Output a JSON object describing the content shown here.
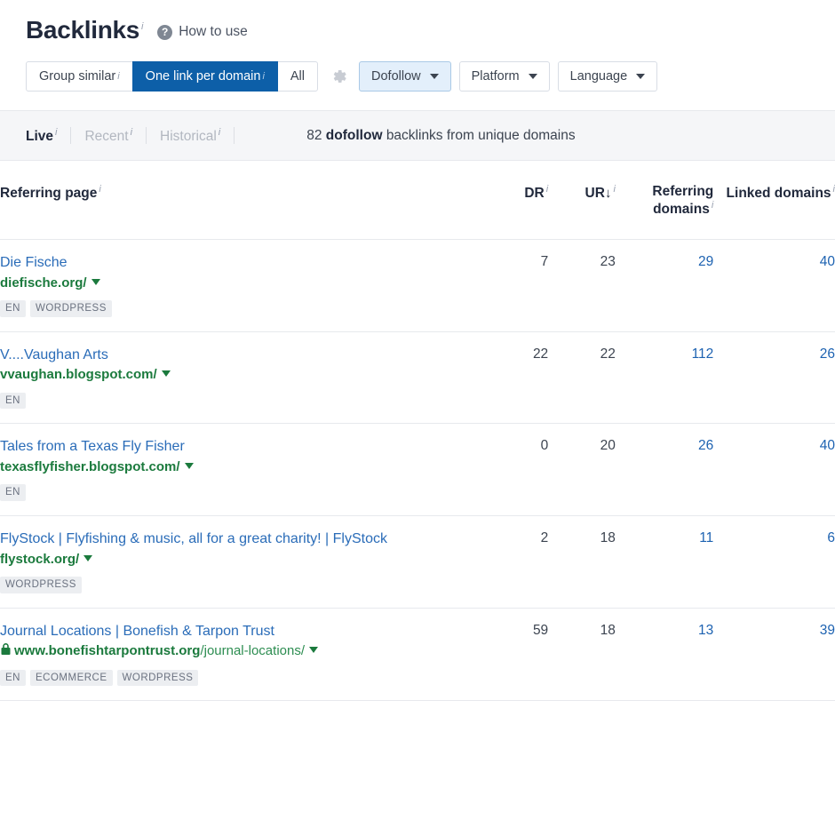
{
  "header": {
    "title": "Backlinks",
    "title_info": "i",
    "how_to_use": "How to use",
    "help_icon": "?"
  },
  "toolbar": {
    "segments": [
      {
        "label": "Group similar",
        "info": "i",
        "active": false
      },
      {
        "label": "One link per domain",
        "info": "i",
        "active": true
      },
      {
        "label": "All",
        "info": "",
        "active": false
      }
    ],
    "gear_icon": "gear-icon",
    "filters": [
      {
        "label": "Dofollow",
        "selected": true
      },
      {
        "label": "Platform",
        "selected": false
      },
      {
        "label": "Language",
        "selected": false
      }
    ],
    "accent_color": "#0d5fa8",
    "selected_filter_bg": "#e3effb"
  },
  "subbar": {
    "states": [
      {
        "label": "Live",
        "info": "i",
        "active": true
      },
      {
        "label": "Recent",
        "info": "i",
        "active": false
      },
      {
        "label": "Historical",
        "info": "i",
        "active": false
      }
    ],
    "summary_count": "82",
    "summary_emphasis": "dofollow",
    "summary_prefix": "",
    "summary_suffix": "backlinks from unique domains"
  },
  "table": {
    "columns": [
      {
        "key": "page",
        "label": "Referring page",
        "info": "i"
      },
      {
        "key": "dr",
        "label": "DR",
        "info": "i"
      },
      {
        "key": "ur",
        "label": "UR",
        "info": "i",
        "sort": "desc",
        "sort_glyph": "↓"
      },
      {
        "key": "rd",
        "label": "Referring domains",
        "info": "i"
      },
      {
        "key": "ld",
        "label": "Linked domains",
        "info": "i"
      }
    ],
    "rows": [
      {
        "title": "Die Fische",
        "domain": "diefische.org/",
        "path": "",
        "https": false,
        "tags": [
          "EN",
          "WORDPRESS"
        ],
        "dr": "7",
        "ur": "23",
        "referring_domains": "29",
        "linked_domains": "40"
      },
      {
        "title": "V....Vaughan Arts",
        "domain": "vvaughan.blogspot.com/",
        "path": "",
        "https": false,
        "tags": [
          "EN"
        ],
        "dr": "22",
        "ur": "22",
        "referring_domains": "112",
        "linked_domains": "26"
      },
      {
        "title": "Tales from a Texas Fly Fisher",
        "domain": "texasflyfisher.blogspot.com/",
        "path": "",
        "https": false,
        "tags": [
          "EN"
        ],
        "dr": "0",
        "ur": "20",
        "referring_domains": "26",
        "linked_domains": "40"
      },
      {
        "title": "FlyStock | Flyfishing & music, all for a great charity! | FlyStock",
        "domain": "flystock.org/",
        "path": "",
        "https": false,
        "tags": [
          "WORDPRESS"
        ],
        "dr": "2",
        "ur": "18",
        "referring_domains": "11",
        "linked_domains": "6"
      },
      {
        "title": "Journal Locations | Bonefish & Tarpon Trust",
        "domain": "www.bonefishtarpontrust.org",
        "path": "/journal-locations/",
        "https": true,
        "tags": [
          "EN",
          "ECOMMERCE",
          "WORDPRESS"
        ],
        "dr": "59",
        "ur": "18",
        "referring_domains": "13",
        "linked_domains": "39"
      }
    ]
  },
  "colors": {
    "link_blue": "#2a6cb8",
    "url_green": "#1b7a3d",
    "tab_active": "#0d5fa8",
    "tag_bg": "#eceef1"
  }
}
